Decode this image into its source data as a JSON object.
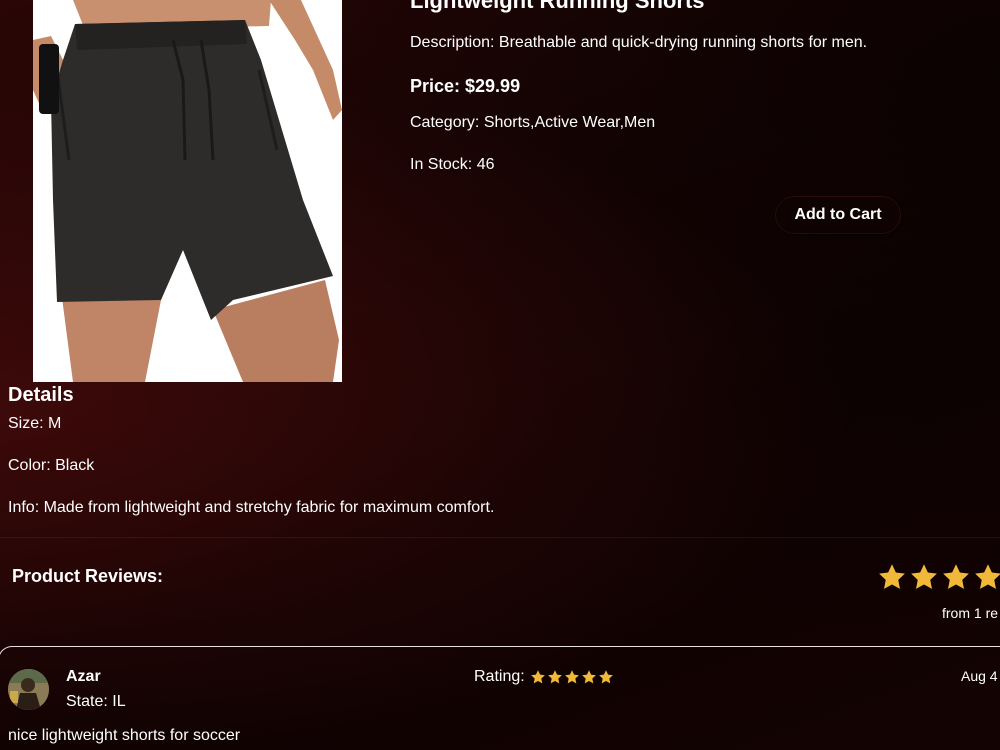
{
  "product": {
    "title": "Lightweight Running Shorts",
    "description": "Description: Breathable and quick-drying running shorts for men.",
    "price": "Price: $29.99",
    "category": "Category: Shorts,Active Wear,Men",
    "stock": "In Stock: 46",
    "add_to_cart_label": "Add to Cart",
    "image_alt": "product-photo-black-running-shorts"
  },
  "details": {
    "heading": "Details",
    "size": "Size: M",
    "color": "Color: Black",
    "info": "Info: Made from lightweight and stretchy fabric for maximum comfort."
  },
  "reviews": {
    "heading": "Product Reviews:",
    "summary_rating": 5,
    "summary_count_text": "from 1 re",
    "star_color": "#f0b93a",
    "items": [
      {
        "name": "Azar",
        "state": "State: IL",
        "rating_label": "Rating:",
        "rating": 5,
        "date": "Aug 4",
        "text": "nice lightweight shorts for soccer"
      }
    ]
  },
  "colors": {
    "background_dark": "#0e0202",
    "background_accent": "#2a0606",
    "text": "#ffffff"
  }
}
